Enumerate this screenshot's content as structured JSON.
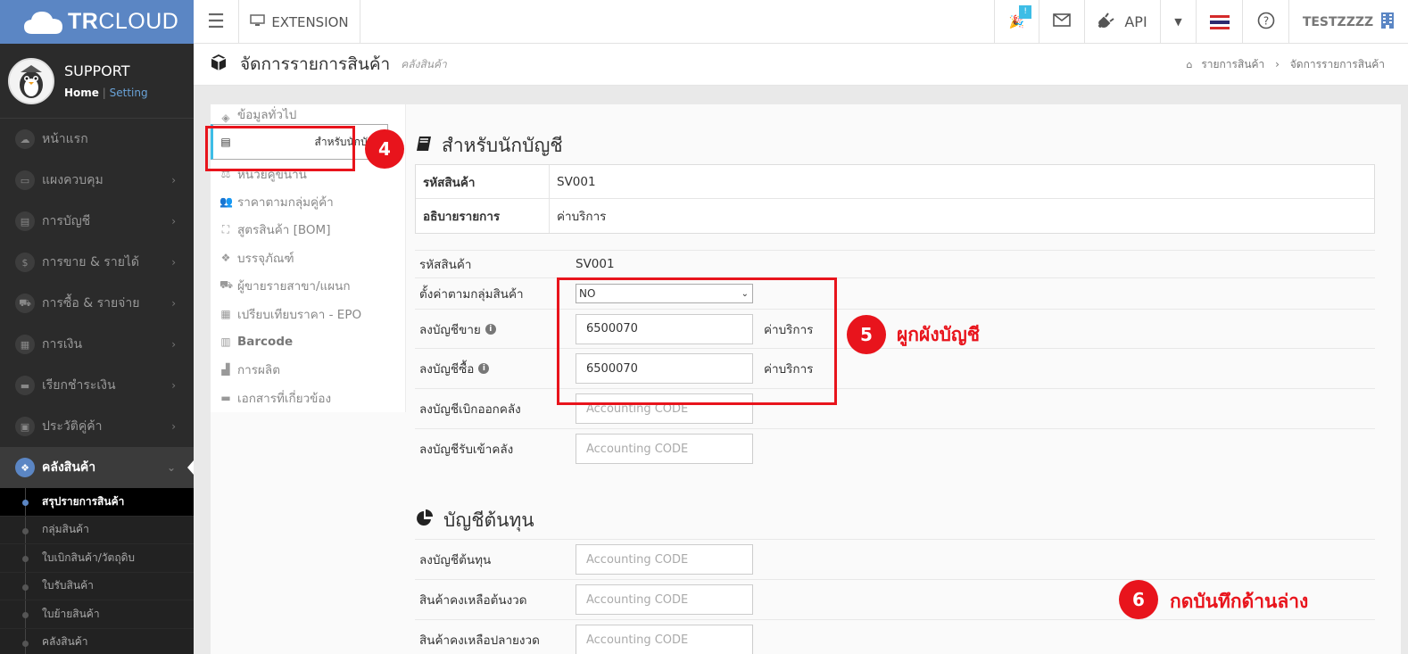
{
  "topbar": {
    "brand_bold": "TR",
    "brand_rest": "CLOUD",
    "extension_label": "EXTENSION",
    "notification_count": "!",
    "api_label": "API",
    "user_name": "TESTZZZZ"
  },
  "profile": {
    "name": "SUPPORT",
    "home_link": "Home",
    "setting_link": "Setting"
  },
  "sidebar": {
    "items": [
      {
        "label": "หน้าแรก"
      },
      {
        "label": "แผงควบคุม"
      },
      {
        "label": "การบัญชี"
      },
      {
        "label": "การขาย & รายได้"
      },
      {
        "label": "การซื้อ & รายจ่าย"
      },
      {
        "label": "การเงิน"
      },
      {
        "label": "เรียกชำระเงิน"
      },
      {
        "label": "ประวัติคู่ค้า"
      },
      {
        "label": "คลังสินค้า"
      }
    ],
    "subitems": [
      {
        "label": "สรุปรายการสินค้า"
      },
      {
        "label": "กลุ่มสินค้า"
      },
      {
        "label": "ใบเบิกสินค้า/วัตถุดิบ"
      },
      {
        "label": "ใบรับสินค้า"
      },
      {
        "label": "ใบย้ายสินค้า"
      },
      {
        "label": "คลังสินค้า"
      }
    ]
  },
  "page": {
    "title": "จัดการรายการสินค้า",
    "subtitle": "คลังสินค้า",
    "breadcrumb": [
      "รายการสินค้า",
      "จัดการรายการสินค้า"
    ]
  },
  "tabs": [
    {
      "label": "ข้อมูลทั่วไป"
    },
    {
      "label": "สำหรับนักบัญชี"
    },
    {
      "label": "หน่วยคู่ขนาน"
    },
    {
      "label": "ราคาตามกลุ่มคู่ค้า"
    },
    {
      "label": "สูตรสินค้า [BOM]"
    },
    {
      "label": "บรรจุภัณฑ์"
    },
    {
      "label": "ผู้ขายรายสาขา/แผนก"
    },
    {
      "label": "เปรียบเทียบราคา - EPO"
    },
    {
      "label": "Barcode"
    },
    {
      "label": "การผลิต"
    },
    {
      "label": "เอกสารที่เกี่ยวข้อง"
    }
  ],
  "accounting": {
    "section_title": "สำหรับนักบัญชี",
    "summary": [
      {
        "key": "รหัสสินค้า",
        "value": "SV001"
      },
      {
        "key": "อธิบายรายการ",
        "value": "ค่าบริการ"
      }
    ],
    "code_label": "รหัสสินค้า",
    "code_value": "SV001",
    "group_label": "ตั้งค่าตามกลุ่มสินค้า",
    "group_value": "NO",
    "sales_label": "ลงบัญชีขาย",
    "sales_value": "6500070",
    "sales_desc": "ค่าบริการ",
    "purchase_label": "ลงบัญชีซื้อ",
    "purchase_value": "6500070",
    "purchase_desc": "ค่าบริการ",
    "issue_label": "ลงบัญชีเบิกออกคลัง",
    "receive_label": "ลงบัญชีรับเข้าคลัง",
    "placeholder": "Accounting CODE"
  },
  "cost": {
    "section_title": "บัญชีต้นทุน",
    "cost_label": "ลงบัญชีต้นทุน",
    "opening_label": "สินค้าคงเหลือต้นงวด",
    "closing_label": "สินค้าคงเหลือปลายงวด",
    "placeholder": "Accounting CODE"
  },
  "annotations": {
    "step4": "4",
    "step5": "5",
    "step5_text": "ผูกผังบัญชี",
    "step6": "6",
    "step6_text": "กดบันทึกด้านล่าง",
    "color": "#e8141c"
  }
}
